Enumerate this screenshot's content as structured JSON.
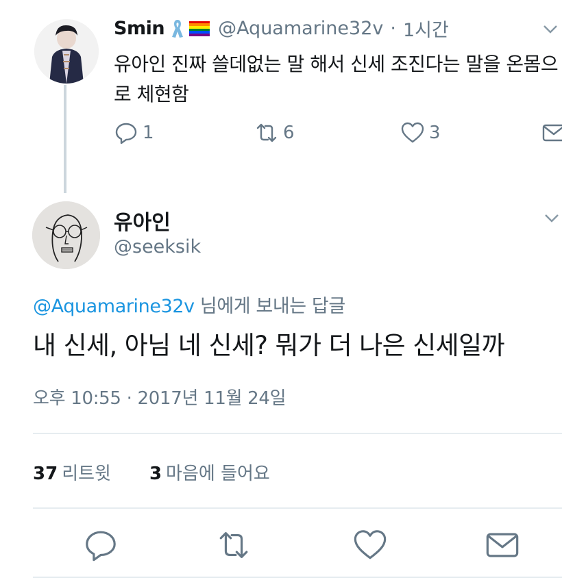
{
  "parent": {
    "name": "Smin",
    "handle": "@Aquamarine32v",
    "separator": "·",
    "time": "1시간",
    "text": "유아인 진짜 쓸데없는 말 해서 신세 조진다는 말을 온몸으로 체현함",
    "reply_count": "1",
    "retweet_count": "6",
    "like_count": "3"
  },
  "tweet": {
    "name": "유아인",
    "handle": "@seeksik",
    "replying_to": "@Aquamarine32v",
    "replying_suffix": " 님에게 보내는 답글",
    "text": "내 신세, 아님 네 신세? 뭐가 더 나은 신세일까",
    "timestamp": "오후 10:55 · 2017년 11월 24일",
    "retweets": "37",
    "retweets_label": "리트윗",
    "likes": "3",
    "likes_label": "마음에 들어요"
  },
  "colors": {
    "text": "#14171a",
    "secondary": "#657786",
    "link": "#1b95e0",
    "divider": "#e6ecf0",
    "thread_line": "#ccd6dd",
    "ribbon": "#7ab8e0"
  },
  "icons": {
    "reply": "reply-icon",
    "retweet": "retweet-icon",
    "like": "heart-icon",
    "message": "envelope-icon",
    "caret": "chevron-down-icon"
  }
}
